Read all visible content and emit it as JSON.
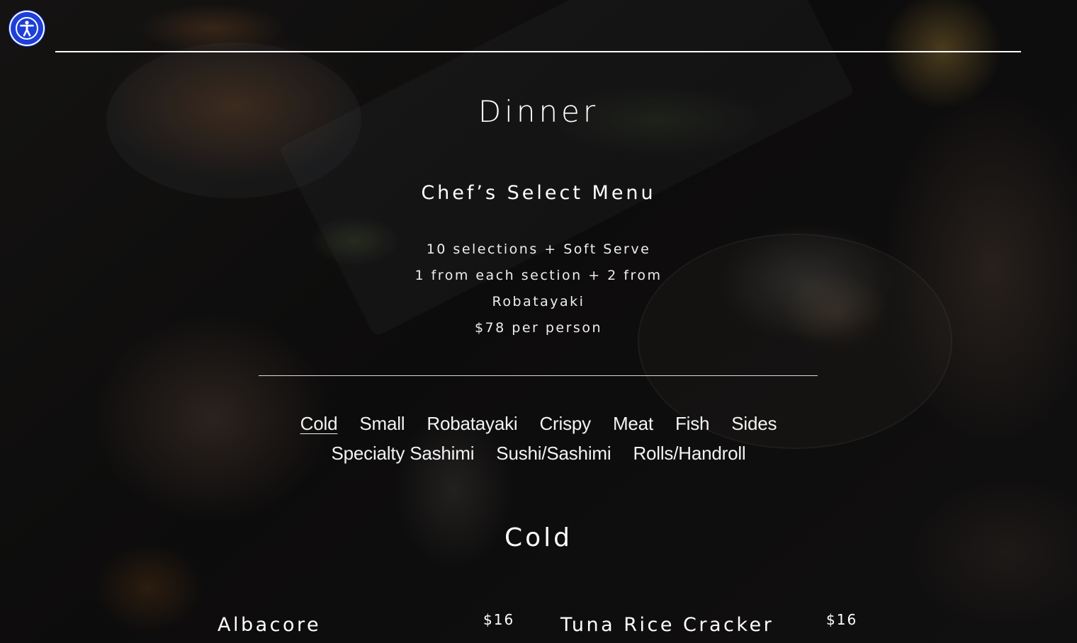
{
  "accessibility": {
    "icon": "accessibility-icon",
    "color": "#1e3fd8"
  },
  "page": {
    "title": "Dinner"
  },
  "menu": {
    "name": "Chef’s Select Menu",
    "description_lines": [
      "10 selections + Soft Serve",
      "1 from each section + 2 from",
      "Robatayaki",
      "$78 per person"
    ]
  },
  "categories": {
    "row1": [
      "Cold",
      "Small",
      "Robatayaki",
      "Crispy",
      "Meat",
      "Fish",
      "Sides"
    ],
    "row2": [
      "Specialty Sashimi",
      "Sushi/Sashimi",
      "Rolls/Handroll"
    ],
    "active": "Cold"
  },
  "section": {
    "title": "Cold",
    "items": [
      {
        "name": "Albacore",
        "price": "$16"
      },
      {
        "name": "Tuna Rice Cracker",
        "price": "$16"
      }
    ]
  }
}
